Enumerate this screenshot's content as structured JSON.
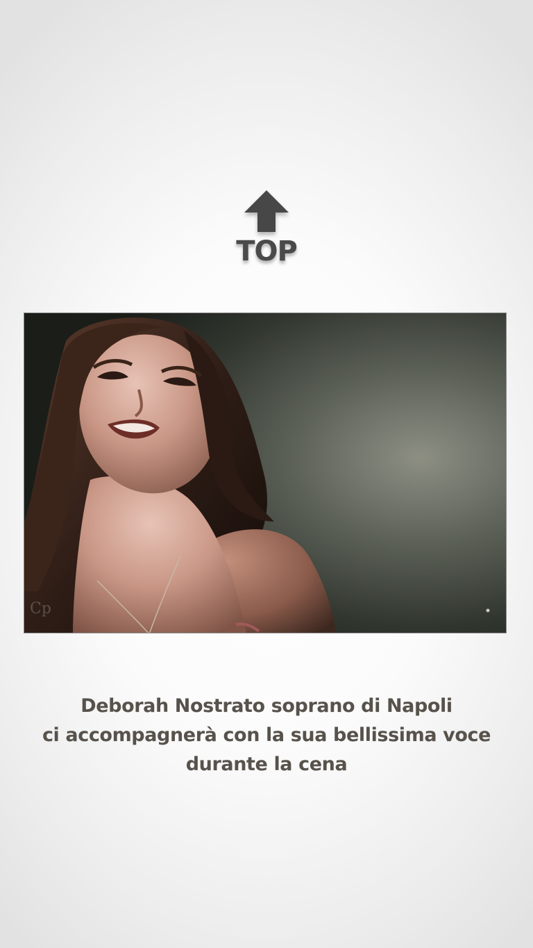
{
  "top_button": {
    "label": "TOP",
    "icon": "arrow-up-icon"
  },
  "photo": {
    "subject": "Deborah Nostrato",
    "watermark": "Cp"
  },
  "caption": {
    "lines": [
      "Deborah Nostrato soprano di Napoli",
      "ci accompagnerà con la sua bellissima voce",
      "durante la cena"
    ]
  },
  "colors": {
    "caption_text": "#57524b",
    "top_text": "#4a4a4a",
    "arrow": "#474747"
  }
}
